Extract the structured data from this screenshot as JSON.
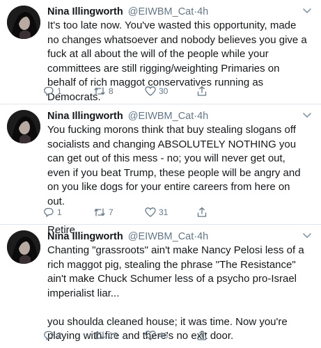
{
  "tweets": [
    {
      "name": "Nina Illingworth",
      "handle": "@EIWBM_Cat",
      "separator": "·",
      "time": "4h",
      "text": "It's too late now. You've wasted this opportunity, made no changes whatsoever and nobody believes you give a fuck at all about the will of the people while your committees are still rigging/weighting Primaries on behalf of rich maggot conservatives running as Democrats.",
      "replies": "1",
      "retweets": "8",
      "likes": "30"
    },
    {
      "name": "Nina Illingworth",
      "handle": "@EIWBM_Cat",
      "separator": "·",
      "time": "4h",
      "text": "You fucking morons think that buy stealing slogans off socialists and changing ABSOLUTELY NOTHING you can get out of this mess - no; you will never get out, even if you beat Trump, these people will be angry and on you like dogs for your entire careers from here on out.\n\nRetire",
      "replies": "1",
      "retweets": "7",
      "likes": "31"
    },
    {
      "name": "Nina Illingworth",
      "handle": "@EIWBM_Cat",
      "separator": "·",
      "time": "4h",
      "text": "Chanting \"grassroots\" ain't make Nancy Pelosi less of a rich maggot pig, stealing the phrase \"The Resistance\" ain't make Chuck Schumer less of a psycho pro-Israel imperialist liar...\n\nyou shoulda cleaned house; it was time. Now you're playing with fire and there's no exit door.",
      "replies": "2",
      "retweets": "19",
      "likes": "46"
    }
  ],
  "icons": {
    "reply": "reply-icon",
    "retweet": "retweet-icon",
    "like": "heart-icon",
    "share": "share-icon",
    "more": "chevron-down-icon"
  },
  "colors": {
    "text": "#14171a",
    "secondary": "#657786",
    "divider": "#e1e8ed"
  }
}
